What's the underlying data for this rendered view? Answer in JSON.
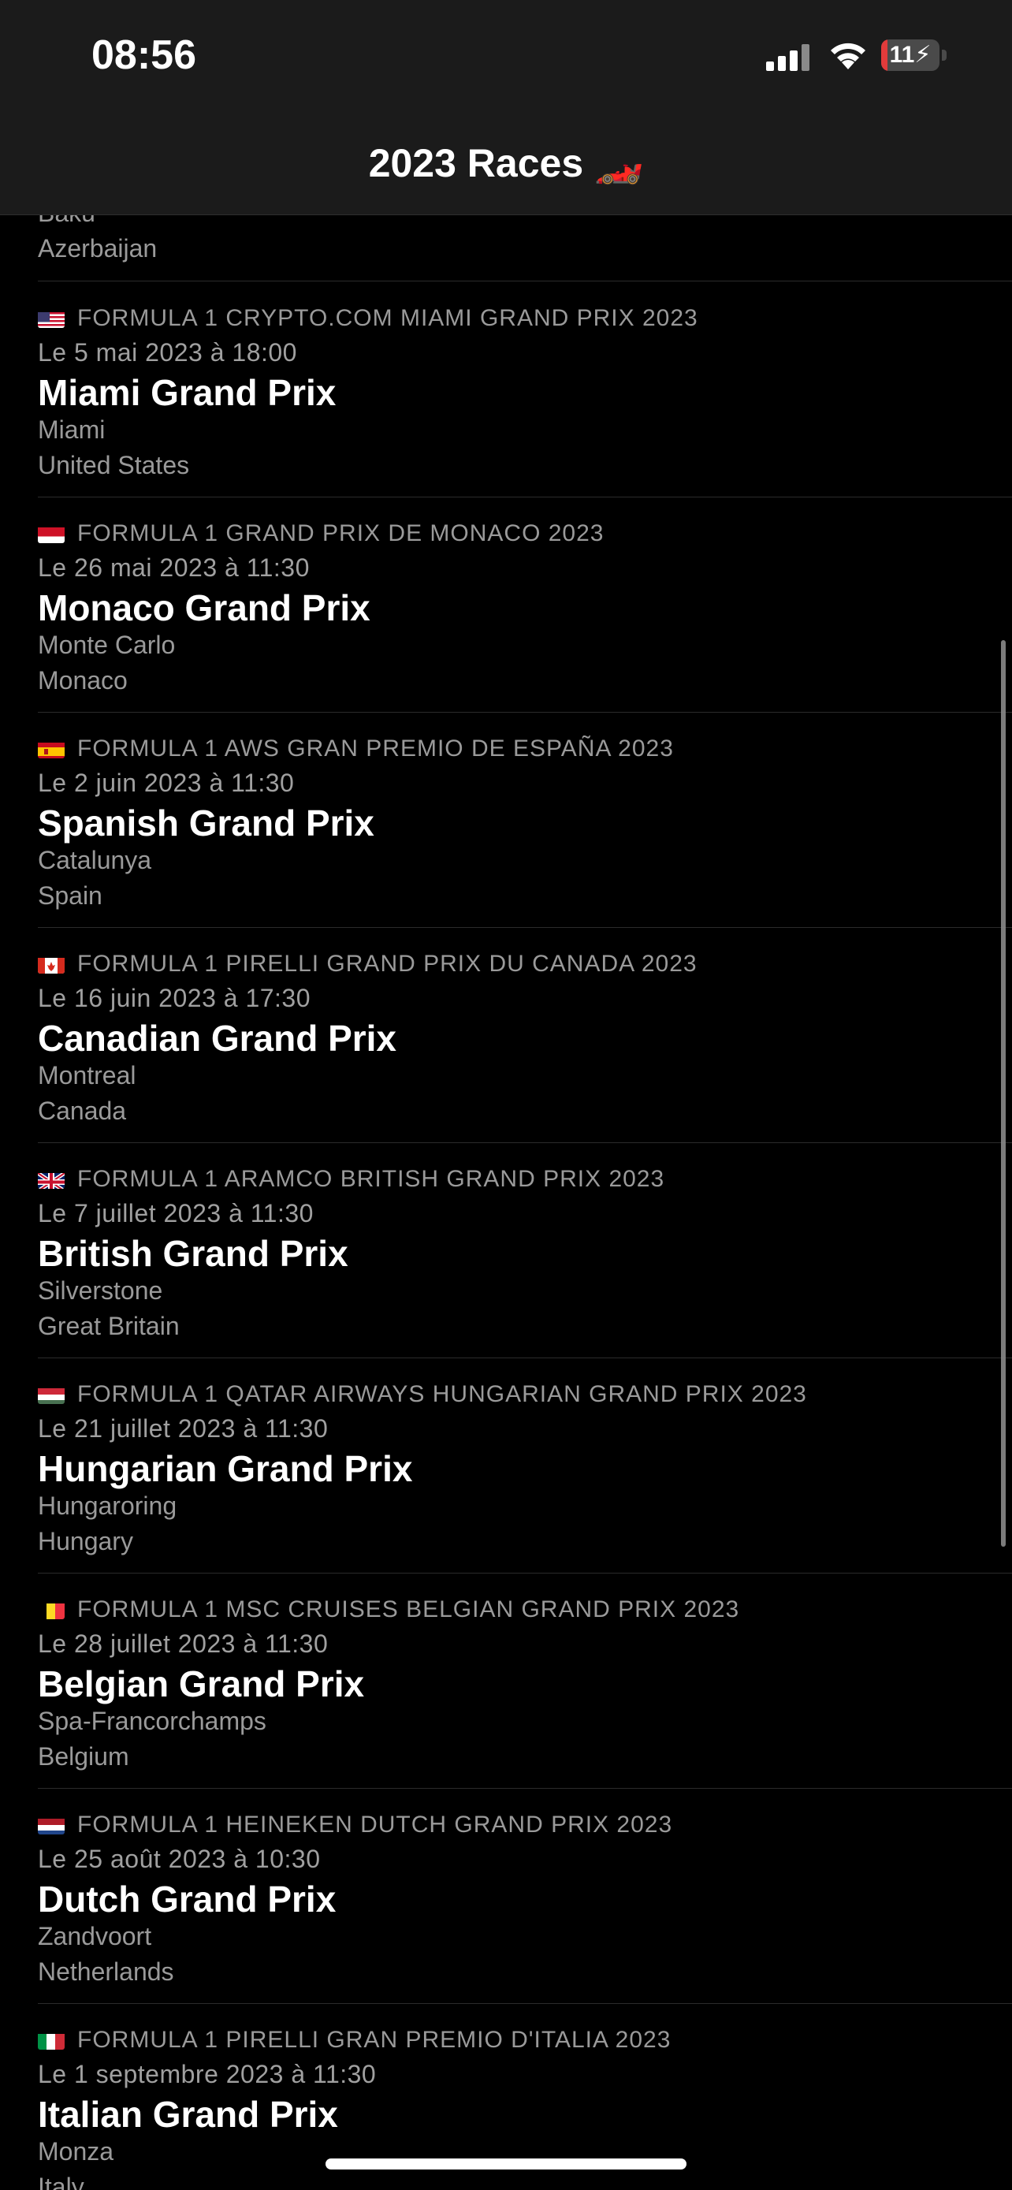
{
  "status_bar": {
    "time": "08:56",
    "battery_percent": "11",
    "battery_level": 0.11,
    "battery_color": "#e23b3b"
  },
  "nav": {
    "title": "2023 Races 🏎️"
  },
  "previous_race": {
    "city": "Baku",
    "country": "Azerbaijan"
  },
  "races": [
    {
      "flag": "us",
      "official_name": "FORMULA 1 CRYPTO.COM MIAMI GRAND PRIX 2023",
      "date": "Le 5 mai 2023 à 18:00",
      "name": "Miami Grand Prix",
      "city": "Miami",
      "country": "United States"
    },
    {
      "flag": "mc",
      "official_name": "FORMULA 1 GRAND PRIX DE MONACO 2023",
      "date": "Le 26 mai 2023 à 11:30",
      "name": "Monaco Grand Prix",
      "city": "Monte Carlo",
      "country": "Monaco"
    },
    {
      "flag": "es",
      "official_name": "FORMULA 1 AWS GRAN PREMIO DE ESPAÑA 2023",
      "date": "Le 2 juin 2023 à 11:30",
      "name": "Spanish Grand Prix",
      "city": "Catalunya",
      "country": "Spain"
    },
    {
      "flag": "ca",
      "official_name": "FORMULA 1 PIRELLI GRAND PRIX DU CANADA 2023",
      "date": "Le 16 juin 2023 à 17:30",
      "name": "Canadian Grand Prix",
      "city": "Montreal",
      "country": "Canada"
    },
    {
      "flag": "gb",
      "official_name": "FORMULA 1 ARAMCO BRITISH GRAND PRIX 2023",
      "date": "Le 7 juillet 2023 à 11:30",
      "name": "British Grand Prix",
      "city": "Silverstone",
      "country": "Great Britain"
    },
    {
      "flag": "hu",
      "official_name": "FORMULA 1 QATAR AIRWAYS HUNGARIAN GRAND PRIX 2023",
      "date": "Le 21 juillet 2023 à 11:30",
      "name": "Hungarian Grand Prix",
      "city": "Hungaroring",
      "country": "Hungary"
    },
    {
      "flag": "be",
      "official_name": "FORMULA 1 MSC CRUISES BELGIAN GRAND PRIX 2023",
      "date": "Le 28 juillet 2023 à 11:30",
      "name": "Belgian Grand Prix",
      "city": "Spa-Francorchamps",
      "country": "Belgium"
    },
    {
      "flag": "nl",
      "official_name": "FORMULA 1 HEINEKEN DUTCH GRAND PRIX 2023",
      "date": "Le 25 août 2023 à 10:30",
      "name": "Dutch Grand Prix",
      "city": "Zandvoort",
      "country": "Netherlands"
    },
    {
      "flag": "it",
      "official_name": "FORMULA 1 PIRELLI GRAN PREMIO D'ITALIA 2023",
      "date": "Le 1 septembre 2023 à 11:30",
      "name": "Italian Grand Prix",
      "city": "Monza",
      "country": "Italy"
    }
  ]
}
